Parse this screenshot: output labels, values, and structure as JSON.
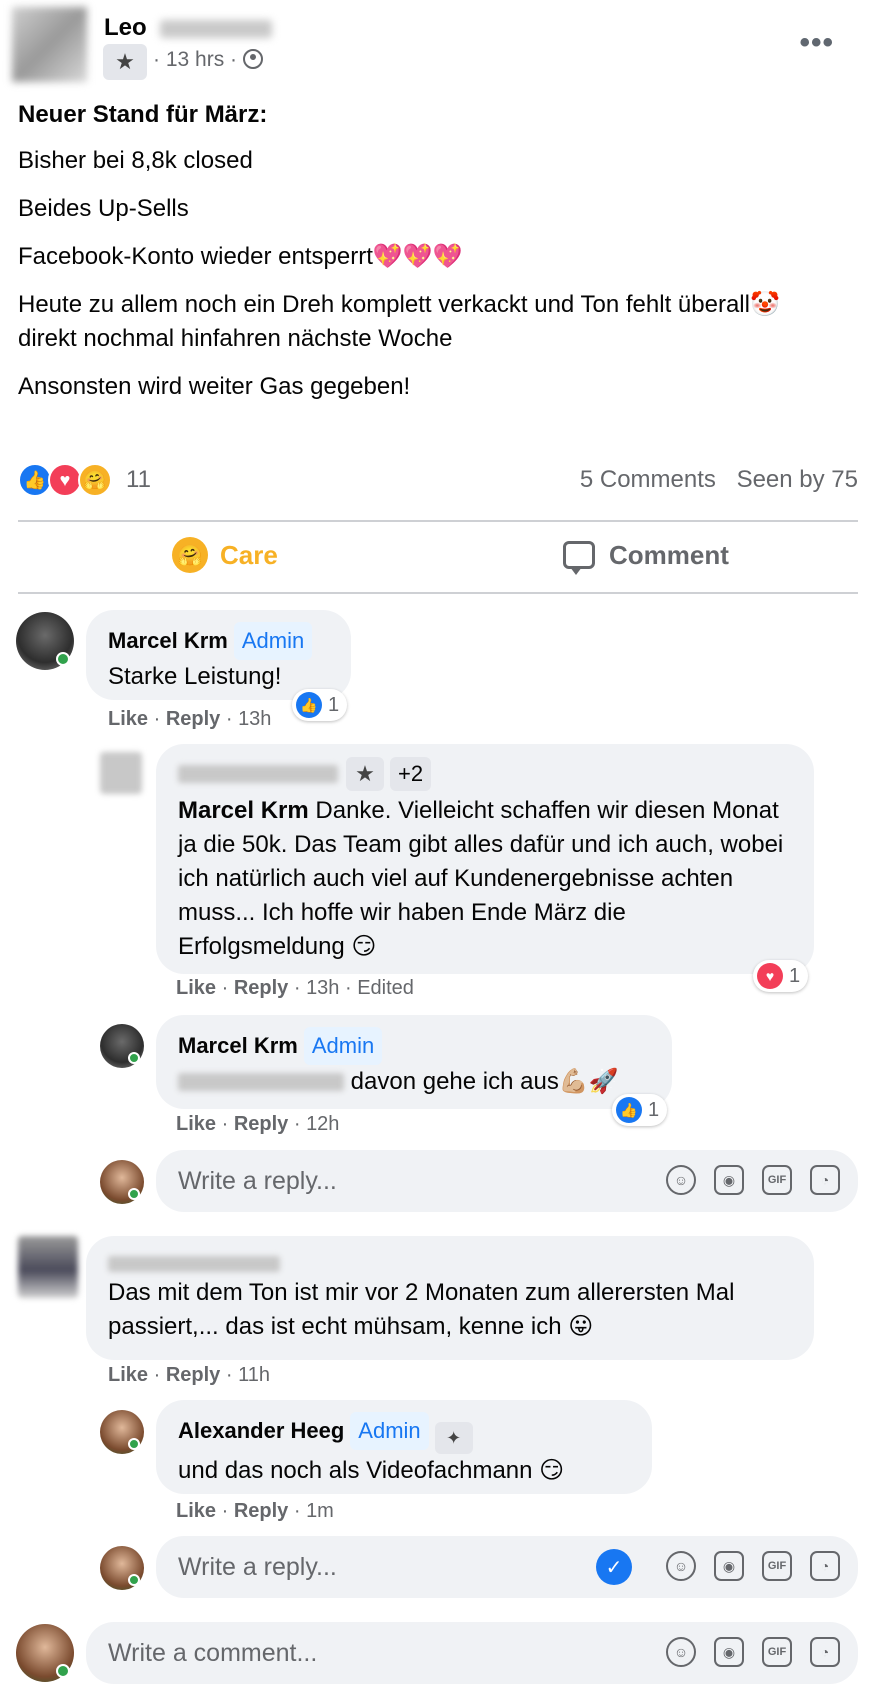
{
  "post": {
    "author": "Leo",
    "time": "13 hrs",
    "more_label": "•••",
    "lines": {
      "l1": "Neuer Stand für März:",
      "l2": "Bisher bei 8,8k closed",
      "l3": "Beides Up-Sells",
      "l4": "Facebook-Konto wieder entsperrt💖💖💖",
      "l5": "Heute zu allem noch ein Dreh komplett verkackt und Ton fehlt überall🤡 direkt nochmal hinfahren nächste Woche",
      "l6": "Ansonsten wird weiter Gas gegeben!"
    },
    "reaction_count": "11",
    "comments_count": "5 Comments",
    "seen_by": "Seen by 75"
  },
  "actions": {
    "care": "Care",
    "comment": "Comment"
  },
  "comments": {
    "c1": {
      "name": "Marcel Krm",
      "badge": "Admin",
      "text": "Starke Leistung!",
      "like": "Like",
      "reply": "Reply",
      "time": "13h",
      "reactions": "1"
    },
    "r1": {
      "extra_badges": "+2",
      "mention": "Marcel Krm",
      "text": "Danke. Vielleicht schaffen wir diesen Monat ja die 50k. Das Team gibt alles dafür und ich auch, wobei ich natürlich auch viel auf Kundenergebnisse achten muss... Ich hoffe wir haben Ende März die Erfolgsmeldung 😏",
      "like": "Like",
      "reply": "Reply",
      "time": "13h",
      "edited": "Edited",
      "reactions": "1"
    },
    "r2": {
      "name": "Marcel Krm",
      "badge": "Admin",
      "text": "davon gehe ich aus💪🏼🚀",
      "like": "Like",
      "reply": "Reply",
      "time": "12h",
      "reactions": "1"
    },
    "c2": {
      "text": "Das mit dem Ton ist mir vor 2 Monaten zum allerersten Mal passiert,... das ist echt mühsam, kenne ich 😛",
      "like": "Like",
      "reply": "Reply",
      "time": "11h"
    },
    "r3": {
      "name": "Alexander Heeg",
      "badge": "Admin",
      "text": "und das noch als Videofachmann 😏",
      "like": "Like",
      "reply": "Reply",
      "time": "1m"
    }
  },
  "inputs": {
    "reply_placeholder": "Write a reply...",
    "comment_placeholder": "Write a comment..."
  },
  "colors": {
    "accent": "#1877f2",
    "care": "#f7b125",
    "bubble": "#f0f2f5",
    "meta": "#65676b",
    "online": "#31a24c"
  }
}
